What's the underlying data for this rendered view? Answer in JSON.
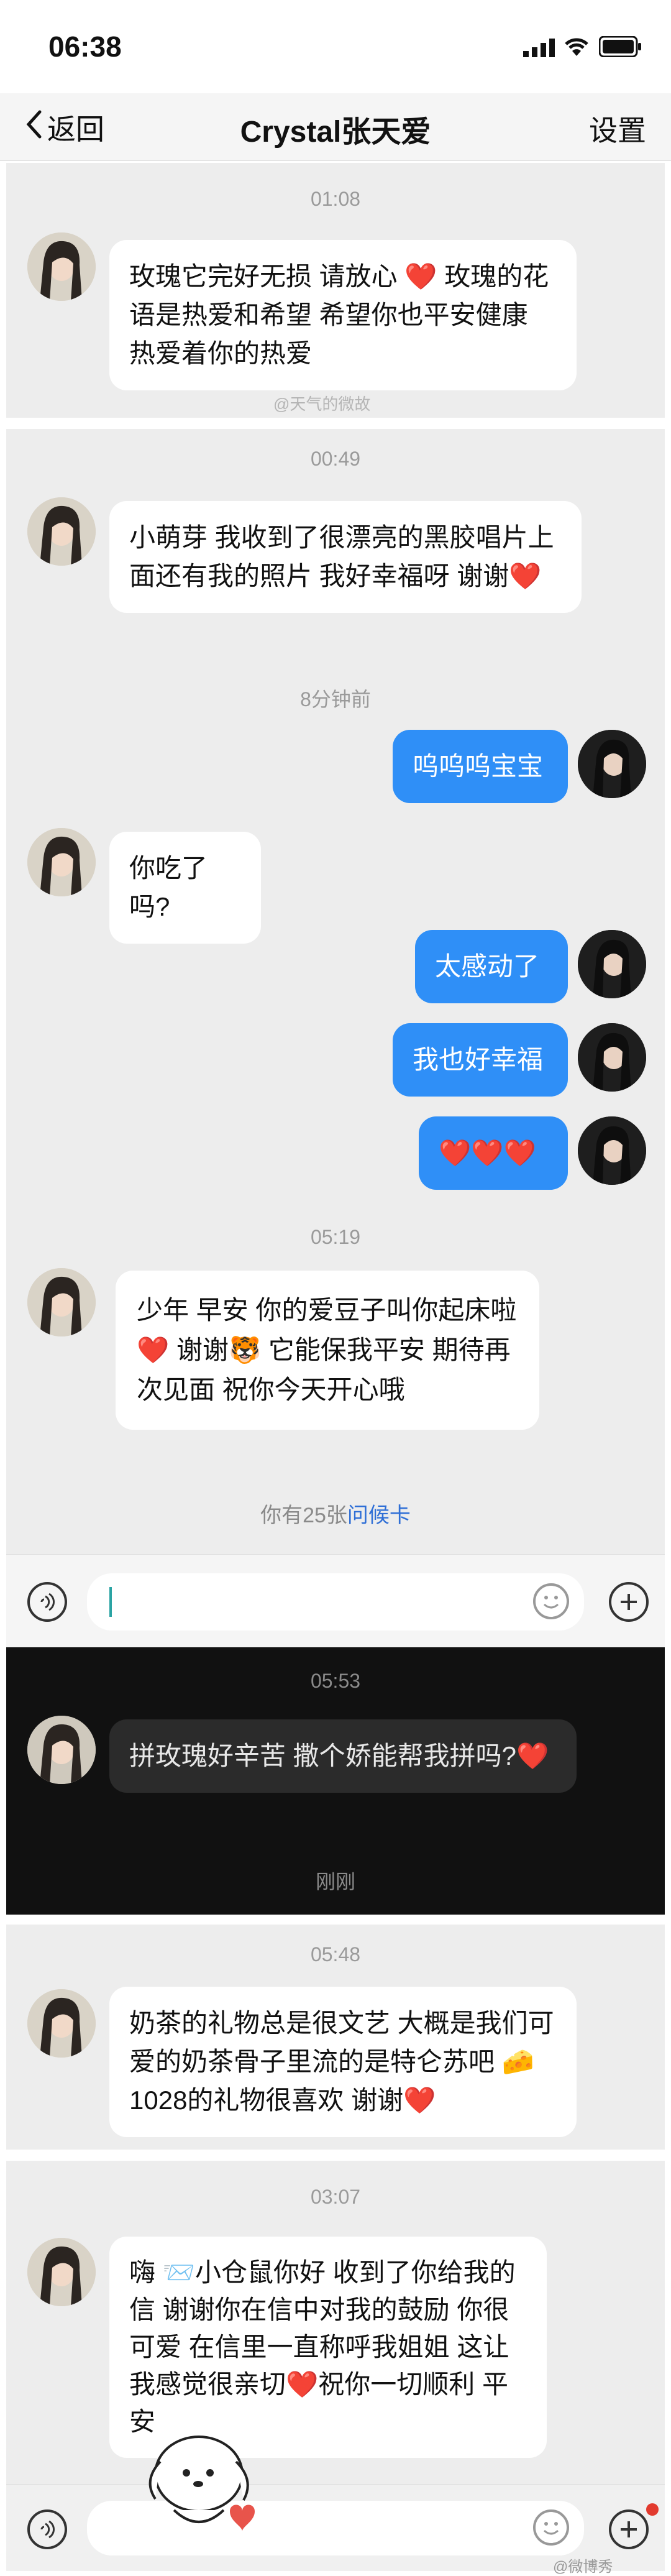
{
  "status": {
    "time": "06:38"
  },
  "nav": {
    "back": "返回",
    "title": "Crystal张天爱",
    "settings": "设置"
  },
  "panel1": {
    "time": "01:08",
    "msg": "玫瑰它完好无损 请放心 ❤️ 玫瑰的花语是热爱和希望 希望你也平安健康 热爱着你的热爱",
    "watermark": "@天气的微故"
  },
  "panel2": {
    "time1": "00:49",
    "msg1": "小萌芽 我收到了很漂亮的黑胶唱片上面还有我的照片 我好幸福呀 谢谢❤️",
    "time2": "8分钟前",
    "me1": "呜呜呜宝宝",
    "msg2": "你吃了吗?",
    "me2": "太感动了",
    "me3": "我也好幸福",
    "me4": "❤️❤️❤️"
  },
  "panel3": {
    "time": "05:19",
    "msg": "少年 早安 你的爱豆子叫你起床啦❤️ 谢谢🐯 它能保我平安 期待再次见面 祝你今天开心哦",
    "card_prefix": "你有25张",
    "card_link": "问候卡"
  },
  "panel4": {
    "time": "05:53",
    "msg": "拼玫瑰好辛苦 撒个娇能帮我拼吗?❤️",
    "footer": "刚刚"
  },
  "panel5": {
    "time": "05:48",
    "msg": "奶茶的礼物总是很文艺 大概是我们可爱的奶茶骨子里流的是特仑苏吧 🧀1028的礼物很喜欢 谢谢❤️"
  },
  "panel6": {
    "time": "03:07",
    "msg": "嗨 📨小仓鼠你好 收到了你给我的信 谢谢你在信中对我的鼓励 你很可爱 在信里一直称呼我姐姐 这让我感觉很亲切❤️祝你一切顺利 平安",
    "watermark": "@微博秀"
  },
  "colors": {
    "accent": "#2f8ff7",
    "heart": "#e23a2e",
    "panel": "#ededed",
    "dark": "#111111"
  }
}
